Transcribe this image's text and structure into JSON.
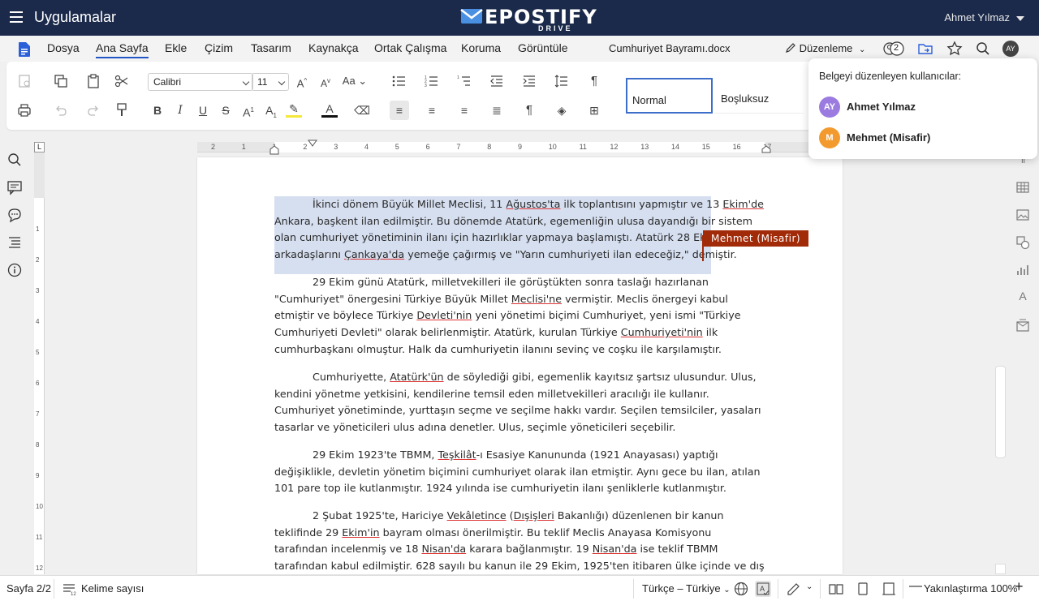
{
  "topbar": {
    "apps_title": "Uygulamalar",
    "logo_text": "EPOSTIFY",
    "logo_sub": "DRIVE",
    "user_name": "Ahmet Yılmaz",
    "brand_color": "#1b2a4a"
  },
  "menubar": {
    "items": [
      "Dosya",
      "Ana Sayfa",
      "Ekle",
      "Çizim",
      "Tasarım",
      "Kaynakça",
      "Ortak Çalışma",
      "Koruma",
      "Görüntüle"
    ],
    "active": "Ana Sayfa",
    "filename": "Cumhuriyet Bayramı.docx",
    "edit_mode": "Düzenleme",
    "collaborator_count": "2",
    "avatar_initials": "AY"
  },
  "ribbon": {
    "font": "Calibri",
    "size": "11",
    "styles": [
      "Normal",
      "Boşluksuz"
    ]
  },
  "popup": {
    "title": "Belgeyi düzenleyen kullanıcılar:",
    "users": [
      {
        "initials": "AY",
        "name": "Ahmet Yılmaz",
        "color": "#9b7be0"
      },
      {
        "initials": "M",
        "name": "Mehmet (Misafir)",
        "color": "#f39a2e"
      }
    ]
  },
  "document": {
    "collaborator_tag": "Mehmet (Misafir)",
    "ruler_numbers": [
      "2",
      "1",
      "1",
      "2",
      "3",
      "4",
      "5",
      "6",
      "7",
      "8",
      "9",
      "10",
      "11",
      "12",
      "13",
      "14",
      "15",
      "16",
      "17"
    ]
  },
  "statusbar": {
    "page": "Sayfa 2/2",
    "word_count": "Kelime sayısı",
    "language": "Türkçe – Türkiye",
    "zoom": "Yakınlaştırma 100%"
  }
}
